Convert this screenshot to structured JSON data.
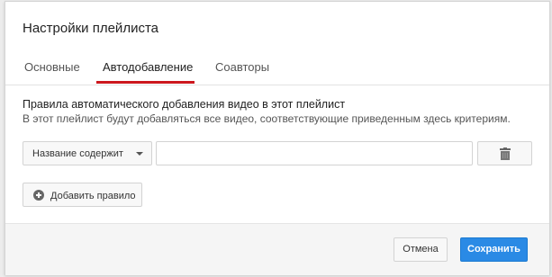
{
  "dialog": {
    "title": "Настройки плейлиста"
  },
  "tabs": [
    {
      "label": "Основные",
      "active": false
    },
    {
      "label": "Автодобавление",
      "active": true
    },
    {
      "label": "Соавторы",
      "active": false
    }
  ],
  "rules": {
    "title": "Правила автоматического добавления видео в этот плейлист",
    "description": "В этот плейлист будут добавляться все видео, соответствующие приведенным здесь критериям.",
    "condition_selected": "Название содержит",
    "value": "",
    "delete_icon": "trash-icon",
    "add_rule_label": "Добавить правило",
    "add_rule_icon": "plus-circle-icon"
  },
  "footer": {
    "cancel_label": "Отмена",
    "save_label": "Сохранить"
  },
  "colors": {
    "active_tab_underline": "#cc181e",
    "primary_button": "#2a8ae5"
  }
}
